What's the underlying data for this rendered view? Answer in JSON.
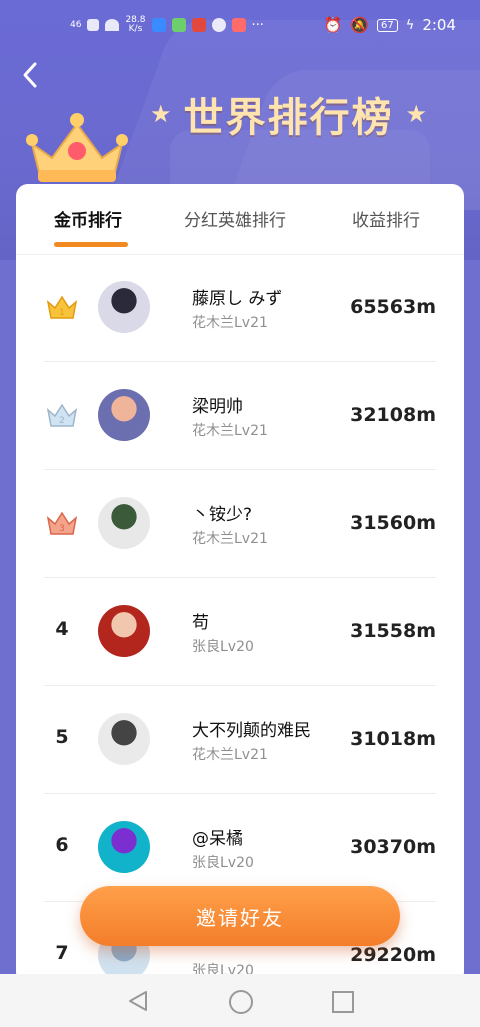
{
  "status": {
    "left_signal": "46",
    "speed": "28.8\nK/s",
    "battery": "67",
    "time": "2:04"
  },
  "header": {
    "title": "世界排行榜"
  },
  "tabs": [
    {
      "label": "金币排行",
      "active": true
    },
    {
      "label": "分红英雄排行",
      "active": false
    },
    {
      "label": "收益排行",
      "active": false
    }
  ],
  "rows": [
    {
      "rank": "1",
      "crown": "gold",
      "name": "藤原し みず",
      "sub": "花木兰Lv21",
      "score": "65563m",
      "avatar_colors": [
        "#d9d9e8",
        "#2a2a3a"
      ]
    },
    {
      "rank": "2",
      "crown": "silver",
      "name": "梁明帅",
      "sub": "花木兰Lv21",
      "score": "32108m",
      "avatar_colors": [
        "#6b6fb0",
        "#f0b49a"
      ]
    },
    {
      "rank": "3",
      "crown": "bronze",
      "name": "丶铵少?",
      "sub": "花木兰Lv21",
      "score": "31560m",
      "avatar_colors": [
        "#e8e8e8",
        "#3a5a3a"
      ]
    },
    {
      "rank": "4",
      "crown": "",
      "name": "苟",
      "sub": "张良Lv20",
      "score": "31558m",
      "avatar_colors": [
        "#b3261e",
        "#f1c8ad"
      ]
    },
    {
      "rank": "5",
      "crown": "",
      "name": "大不列颠的难民",
      "sub": "花木兰Lv21",
      "score": "31018m",
      "avatar_colors": [
        "#eaeaea",
        "#444444"
      ]
    },
    {
      "rank": "6",
      "crown": "",
      "name": "@呆橘",
      "sub": "张良Lv20",
      "score": "30370m",
      "avatar_colors": [
        "#10b3c9",
        "#7b2fd1"
      ]
    },
    {
      "rank": "7",
      "crown": "",
      "name": "",
      "sub": "张良Lv20",
      "score": "29220m",
      "avatar_colors": [
        "#cfe0ee",
        "#89a9c7"
      ]
    }
  ],
  "invite_label": "邀请好友",
  "colors": {
    "accent": "#f28a22",
    "background": "#6b6bd6"
  }
}
